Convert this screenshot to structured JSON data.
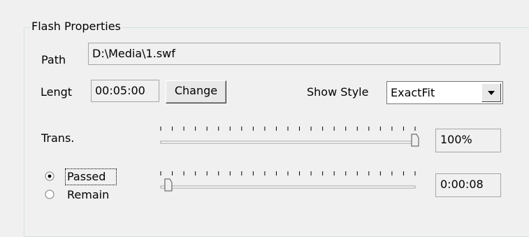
{
  "group": {
    "title": "Flash Properties"
  },
  "path": {
    "label": "Path",
    "value": "D:\\Media\\1.swf"
  },
  "length": {
    "label": "Lengt",
    "value": "00:05:00",
    "change_button": "Change"
  },
  "show_style": {
    "label": "Show Style",
    "selected": "ExactFit",
    "icon": "chevron-down-icon"
  },
  "transparency": {
    "label": "Trans.",
    "slider_fraction": 1.0,
    "value": "100%"
  },
  "time_mode": {
    "passed_label": "Passed",
    "remain_label": "Remain",
    "selected": "passed",
    "slider_fraction": 0.03,
    "value": "0:00:08"
  }
}
